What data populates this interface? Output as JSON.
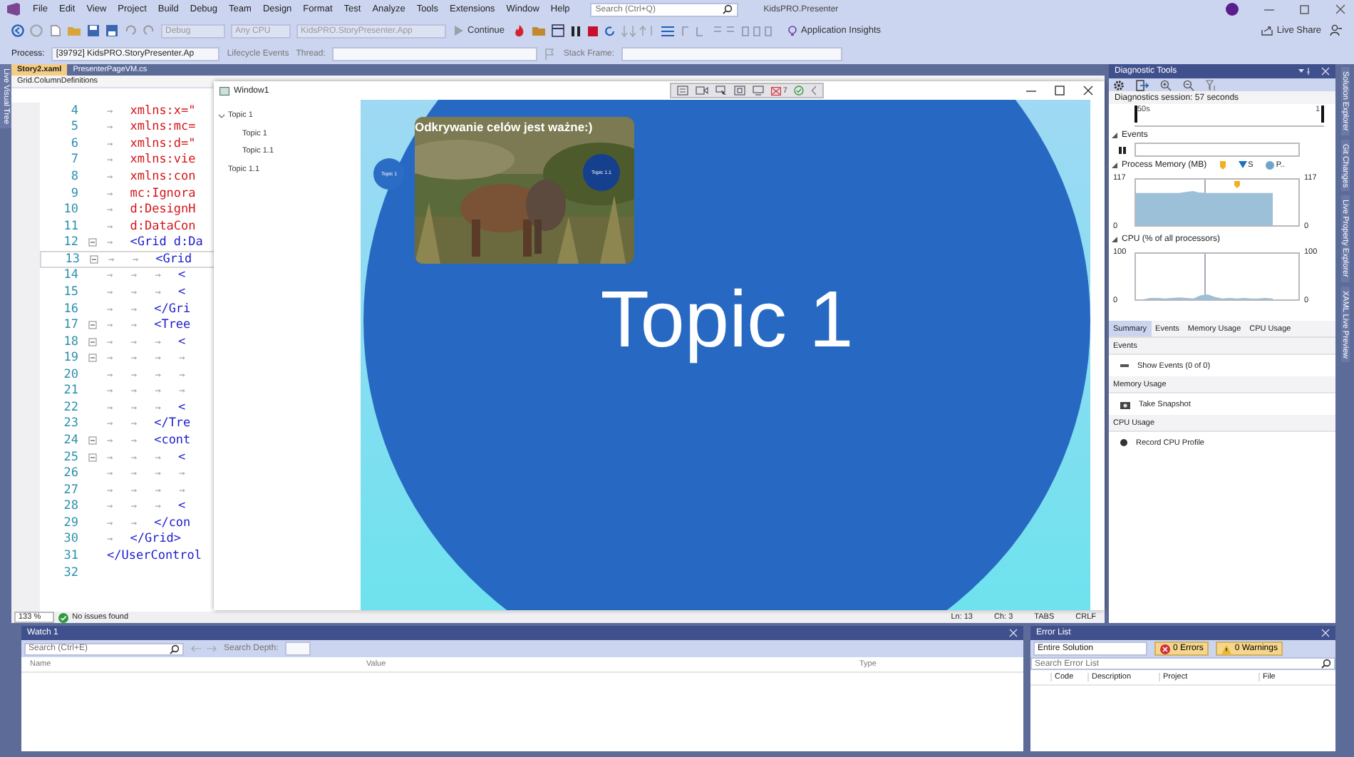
{
  "title_bar": {
    "menu": [
      "File",
      "Edit",
      "View",
      "Project",
      "Build",
      "Debug",
      "Team",
      "Design",
      "Format",
      "Test",
      "Analyze",
      "Tools",
      "Extensions",
      "Window",
      "Help"
    ],
    "search": {
      "placeholder": "Search (Ctrl+Q)"
    },
    "title": "KidsPRO.Presenter"
  },
  "toolbar": {
    "configuration": "Debug",
    "platform": "Any CPU",
    "startup": "KidsPRO.StoryPresenter.App",
    "continue": "Continue",
    "insights": "Application Insights",
    "live_share": "Live Share"
  },
  "debug_bar": {
    "process_label": "Process:",
    "process": "[39792] KidsPRO.StoryPresenter.Ap",
    "lifecycle": "Lifecycle Events",
    "thread_label": "Thread:",
    "stack_label": "Stack Frame:"
  },
  "left_tabs": [
    "Live Visual Tree"
  ],
  "editor": {
    "tabs": [
      {
        "label": "Story2.xaml",
        "selected": true
      },
      {
        "label": "PresenterPageVM.cs",
        "selected": false
      }
    ],
    "breadcrumb": "Grid.ColumnDefinitions",
    "lines": [
      {
        "number": "4",
        "tabs": "→",
        "code": "xmlns:x=\"",
        "kind": "attr",
        "fold": false,
        "current": false
      },
      {
        "number": "5",
        "tabs": "→",
        "code": "xmlns:mc=",
        "kind": "attr",
        "fold": false,
        "current": false
      },
      {
        "number": "6",
        "tabs": "→",
        "code": "xmlns:d=\"",
        "kind": "attr",
        "fold": false,
        "current": false
      },
      {
        "number": "7",
        "tabs": "→",
        "code": "xmlns:vie",
        "kind": "attr",
        "fold": false,
        "current": false
      },
      {
        "number": "8",
        "tabs": "→",
        "code": "xmlns:con",
        "kind": "attr",
        "fold": false,
        "current": false
      },
      {
        "number": "9",
        "tabs": "→",
        "code": "mc:Ignora",
        "kind": "attr",
        "fold": false,
        "current": false
      },
      {
        "number": "10",
        "tabs": "→",
        "code": "d:DesignH",
        "kind": "attr",
        "fold": false,
        "current": false
      },
      {
        "number": "11",
        "tabs": "→",
        "code": "d:DataCon",
        "kind": "attr",
        "fold": false,
        "current": false
      },
      {
        "number": "12",
        "tabs": "→",
        "code": "<Grid d:Da",
        "kind": "tag",
        "fold": true,
        "current": false
      },
      {
        "number": "13",
        "tabs": "→   →",
        "code": "<Grid",
        "kind": "tag",
        "fold": true,
        "current": true
      },
      {
        "number": "14",
        "tabs": "→   →   →",
        "code": "<",
        "kind": "tag",
        "fold": false,
        "current": false
      },
      {
        "number": "15",
        "tabs": "→   →   →",
        "code": "<",
        "kind": "tag",
        "fold": false,
        "current": false
      },
      {
        "number": "16",
        "tabs": "→   →",
        "code": "</Gri",
        "kind": "tag",
        "fold": false,
        "current": false
      },
      {
        "number": "17",
        "tabs": "→   →",
        "code": "<Tree",
        "kind": "tag",
        "fold": true,
        "current": false
      },
      {
        "number": "18",
        "tabs": "→   →   →",
        "code": "<",
        "kind": "tag",
        "fold": true,
        "current": false
      },
      {
        "number": "19",
        "tabs": "→   →   →   →",
        "fold": true,
        "current": false
      },
      {
        "number": "20",
        "tabs": "→   →   →   →",
        "fold": false,
        "current": false
      },
      {
        "number": "21",
        "tabs": "→   →   →   →",
        "fold": false,
        "current": false
      },
      {
        "number": "22",
        "tabs": "→   →   →",
        "code": "<",
        "kind": "tag",
        "fold": false,
        "current": false
      },
      {
        "number": "23",
        "tabs": "→   →",
        "code": "</Tre",
        "kind": "tag",
        "fold": false,
        "current": false
      },
      {
        "number": "24",
        "tabs": "→   →",
        "code": "<cont",
        "kind": "tag",
        "fold": true,
        "current": false
      },
      {
        "number": "25",
        "tabs": "→   →   →",
        "code": "<",
        "kind": "tag",
        "fold": true,
        "current": false
      },
      {
        "number": "26",
        "tabs": "→   →   →   →",
        "fold": false,
        "current": false
      },
      {
        "number": "27",
        "tabs": "→   →   →   →",
        "fold": false,
        "current": false
      },
      {
        "number": "28",
        "tabs": "→   →   →",
        "code": "<",
        "kind": "tag",
        "fold": false,
        "current": false
      },
      {
        "number": "29",
        "tabs": "→   →",
        "code": "</con",
        "kind": "tag",
        "fold": false,
        "current": false
      },
      {
        "number": "30",
        "tabs": "→",
        "code": "</Grid>",
        "kind": "tag",
        "fold": false,
        "current": false
      },
      {
        "number": "31",
        "code": "</UserControl",
        "kind": "tag",
        "fold": false,
        "current": false
      },
      {
        "number": "32",
        "fold": false,
        "current": false
      }
    ],
    "zoom": "133 %",
    "issues": "No issues found",
    "position": [
      "Ln: 13",
      "Ch: 3",
      "TABS",
      "CRLF"
    ]
  },
  "app_window": {
    "title": "Window1",
    "toolbar_count": "7",
    "tree": [
      {
        "label": "Topic 1",
        "expanded": true,
        "children": [
          {
            "label": "Topic 1"
          },
          {
            "label": "Topic 1.1"
          }
        ]
      },
      {
        "label": "Topic 1.1"
      }
    ],
    "card_title": "Odkrywanie celów jest ważne:)",
    "nodes": [
      {
        "label": "Topic 1",
        "kind": "light"
      },
      {
        "label": "Topic 1.1",
        "kind": "dark"
      }
    ],
    "main_topic": "Topic 1"
  },
  "diagnostics": {
    "title": "Diagnostic Tools",
    "session": "Diagnostics session: 57 seconds",
    "timeline": [
      "50s",
      "1"
    ],
    "events_label": "Events",
    "memory": {
      "label": "Process Memory (MB)",
      "legend": [
        {
          "kind": "gc"
        },
        {
          "kind": "snapshot",
          "label": "S"
        },
        {
          "kind": "private",
          "label": "P.."
        }
      ],
      "left_ticks": [
        "117",
        "0"
      ],
      "right_ticks": [
        "117",
        "0"
      ]
    },
    "cpu": {
      "label": "CPU (% of all processors)",
      "right_ticks": [
        "100",
        "0"
      ],
      "chart_data": {
        "type": "area",
        "categories": [
          null,
          null,
          null,
          null,
          null,
          null,
          null,
          null,
          null,
          null,
          null,
          null,
          null,
          null,
          null,
          null,
          null,
          null,
          null,
          null
        ],
        "ylim": [
          0,
          100
        ],
        "yticks": [
          0,
          100
        ],
        "series": [
          {
            "color": "#9bc0d8",
            "values": [
              0,
              0,
              3,
              3,
              2,
              3,
              4,
              3,
              2,
              9,
              11,
              5,
              2,
              3,
              2,
              3,
              2,
              2,
              3,
              2
            ]
          }
        ]
      }
    },
    "tabs": [
      {
        "label": "Summary",
        "selected": true
      },
      {
        "label": "Events",
        "selected": false
      },
      {
        "label": "Memory Usage",
        "selected": false
      },
      {
        "label": "CPU Usage",
        "selected": false
      }
    ],
    "sections": [
      {
        "heading": "Events",
        "action": "Show Events (0 of 0)",
        "kind": "events"
      },
      {
        "heading": "Memory Usage",
        "action": "Take Snapshot",
        "kind": "snapshot"
      },
      {
        "heading": "CPU Usage",
        "action": "Record CPU Profile",
        "kind": "record"
      }
    ]
  },
  "right_tabs": [
    "Solution Explorer",
    "Git Changes",
    "Live Property Explorer",
    "XAML Live Preview"
  ],
  "watch": {
    "title": "Watch 1",
    "search": {
      "placeholder": "Search (Ctrl+E)"
    },
    "depth_label": "Search Depth:",
    "columns": [
      "Name",
      "Value",
      "Type"
    ]
  },
  "error_list": {
    "title": "Error List",
    "scope": "Entire Solution",
    "errors": {
      "label": "0 Errors",
      "on": true
    },
    "warnings": {
      "label": "0 Warnings",
      "on": true
    },
    "search": {
      "placeholder": "Search Error List"
    },
    "columns": [
      "Code",
      "Description",
      "Project",
      "File"
    ]
  }
}
